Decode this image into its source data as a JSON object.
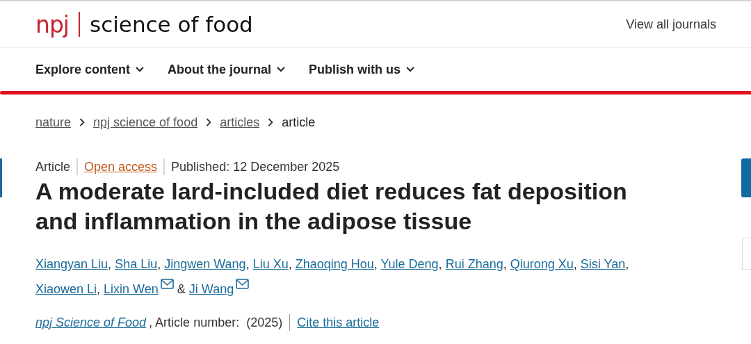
{
  "header": {
    "logo_mark": "npj",
    "journal_name": "science of food",
    "view_all": "View all journals"
  },
  "nav": [
    {
      "label": "Explore content"
    },
    {
      "label": "About the journal"
    },
    {
      "label": "Publish with us"
    }
  ],
  "breadcrumb": [
    {
      "label": "nature",
      "current": false
    },
    {
      "label": "npj science of food",
      "current": false
    },
    {
      "label": "articles",
      "current": false
    },
    {
      "label": "article",
      "current": true
    }
  ],
  "meta": {
    "type": "Article",
    "access": "Open access",
    "published": "Published: 12 December 2025"
  },
  "title": "A moderate lard-included diet reduces fat deposition and inflammation in the adipose tissue",
  "authors": [
    {
      "name": "Xiangyan Liu",
      "separator": ","
    },
    {
      "name": "Sha Liu",
      "separator": ","
    },
    {
      "name": "Jingwen Wang",
      "separator": ","
    },
    {
      "name": "Liu Xu",
      "separator": ","
    },
    {
      "name": "Zhaoqing Hou",
      "separator": ","
    },
    {
      "name": "Yule Deng",
      "separator": ","
    },
    {
      "name": "Rui Zhang",
      "separator": ","
    },
    {
      "name": "Qiurong Xu",
      "separator": ","
    },
    {
      "name": "Sisi Yan",
      "separator": ","
    },
    {
      "name": "Xiaowen Li",
      "separator": ","
    },
    {
      "name": "Lixin Wen",
      "mail": true,
      "conjunction": "&"
    },
    {
      "name": "Ji Wang",
      "mail": true
    }
  ],
  "citation": {
    "journal": "npj Science of Food",
    "article_number": ", Article number:  (2025)",
    "cite": "Cite this article"
  }
}
